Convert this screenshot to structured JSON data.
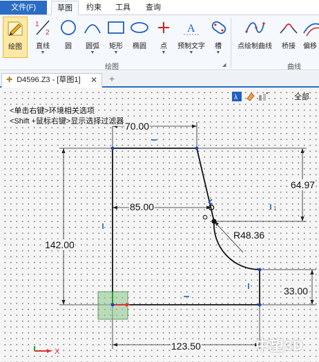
{
  "ribbon_tabs": {
    "file": "文件(F)",
    "tabs": [
      "草图",
      "约束",
      "工具",
      "查询"
    ],
    "active": "草图"
  },
  "ribbon": {
    "buttons": [
      {
        "label": "绘图",
        "icon": "sketch-pencil-icon",
        "selected": true
      },
      {
        "label": "直线",
        "icon": "line-icon",
        "dropdown": true
      },
      {
        "label": "圆",
        "icon": "circle-icon"
      },
      {
        "label": "圆弧",
        "icon": "arc-icon",
        "dropdown": true
      },
      {
        "label": "矩形",
        "icon": "rectangle-icon",
        "dropdown": true
      },
      {
        "label": "椭圆",
        "icon": "ellipse-icon"
      },
      {
        "label": "点",
        "icon": "point-icon",
        "dropdown": true
      },
      {
        "label": "预制文字",
        "icon": "text-icon",
        "dropdown": true
      },
      {
        "label": "槽",
        "icon": "slot-icon",
        "dropdown": true
      },
      {
        "label": "点绘制曲线",
        "icon": "spline-icon"
      },
      {
        "label": "桥接",
        "icon": "bridge-icon"
      },
      {
        "label": "偏移",
        "icon": "offset-icon"
      }
    ],
    "groups": {
      "draw": "绘图",
      "curve": "曲线"
    }
  },
  "document": {
    "tab_title": "D4596.Z3 - [草图1]",
    "new_tab_symbol": "+"
  },
  "canvas": {
    "hints": [
      "<单击右键>环境相关选项",
      "<Shift +鼠标右键>显示选择过滤器"
    ],
    "filter_label": "全部",
    "dimensions": {
      "top_width": "70.00",
      "right_height": "64.97",
      "mid_width": "85.00",
      "radius": "R48.36",
      "left_height": "142.00",
      "step_height": "33.00",
      "bottom_width": "123.50"
    },
    "watermark": "中望3D"
  },
  "colors": {
    "accent": "#2b6cc4",
    "sketch_line": "#111111",
    "constraint": "#1f5fbf",
    "axis_x": "#e03030",
    "axis_y": "#22a022"
  }
}
